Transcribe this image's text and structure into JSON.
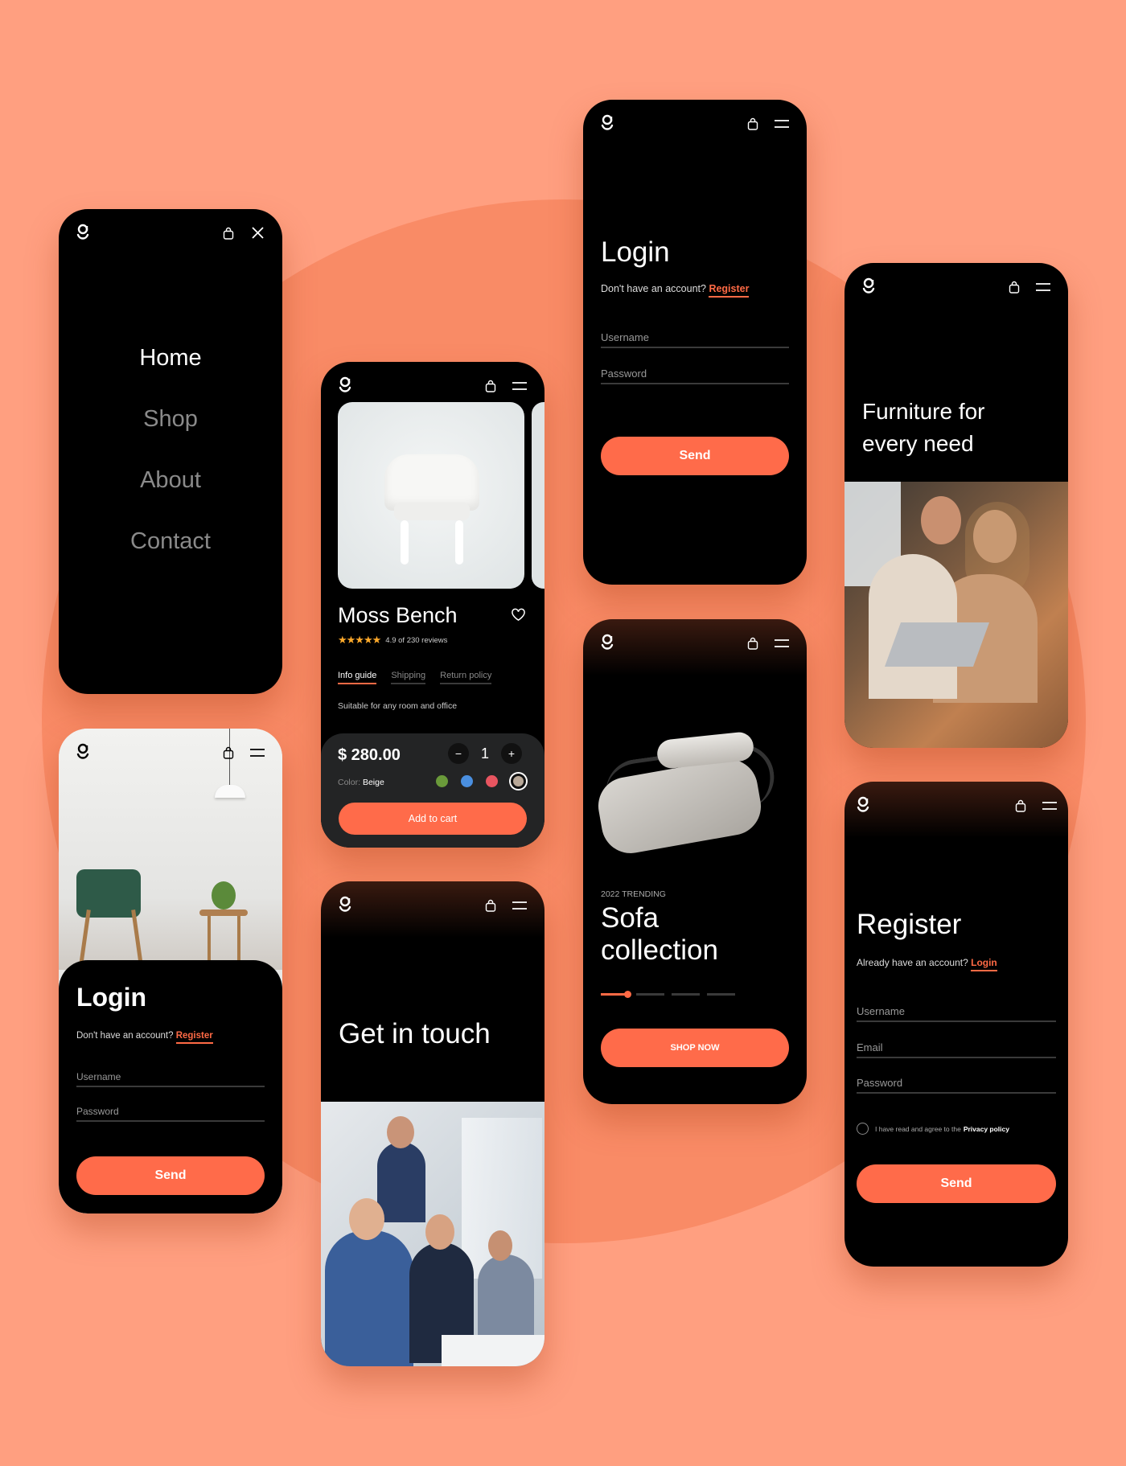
{
  "colors": {
    "accent": "#ff6b4a",
    "background": "#ff9f80",
    "screen": "#000000"
  },
  "icons": {
    "logo": "g-logo-icon",
    "bag": "shopping-bag-icon",
    "menu": "hamburger-menu-icon",
    "close": "close-icon",
    "heart": "heart-icon",
    "star": "star-icon",
    "minus": "minus-icon",
    "plus": "plus-icon"
  },
  "menu_screen": {
    "items": [
      {
        "label": "Home",
        "active": true
      },
      {
        "label": "Shop",
        "active": false
      },
      {
        "label": "About",
        "active": false
      },
      {
        "label": "Contact",
        "active": false
      }
    ]
  },
  "login_photo_screen": {
    "title": "Login",
    "prompt": "Don't have an account?",
    "link": "Register",
    "username_placeholder": "Username",
    "password_placeholder": "Password",
    "button": "Send"
  },
  "product_screen": {
    "name": "Moss Bench",
    "rating_text": "4.9 of 230 reviews",
    "rating": 4.9,
    "stars": 5,
    "tabs": [
      {
        "label": "Info guide",
        "active": true
      },
      {
        "label": "Shipping",
        "active": false
      },
      {
        "label": "Return policy",
        "active": false
      }
    ],
    "description": "Suitable for any room and office",
    "price": "$ 280.00",
    "quantity": "1",
    "color_label": "Color:",
    "color_value": "Beige",
    "swatches": [
      "#6a9a3a",
      "#4a8fe0",
      "#e85560",
      "#b8a898"
    ],
    "button": "Add to cart"
  },
  "contact_screen": {
    "title": "Get in touch"
  },
  "login_screen": {
    "title": "Login",
    "prompt": "Don't have an account?",
    "link": "Register",
    "username_placeholder": "Username",
    "password_placeholder": "Password",
    "button": "Send"
  },
  "sofa_screen": {
    "eyebrow": "2022 TRENDING",
    "title_line1": "Sofa",
    "title_line2": "collection",
    "slides_total": 4,
    "slide_active": 1,
    "button": "SHOP NOW"
  },
  "hero_screen": {
    "title_line1": "Furniture for",
    "title_line2": "every need"
  },
  "register_screen": {
    "title": "Register",
    "prompt": "Already have an account?",
    "link": "Login",
    "username_placeholder": "Username",
    "email_placeholder": "Email",
    "password_placeholder": "Password",
    "agree_text": "I have read and agree to the",
    "agree_link": "Privacy policy",
    "button": "Send"
  }
}
